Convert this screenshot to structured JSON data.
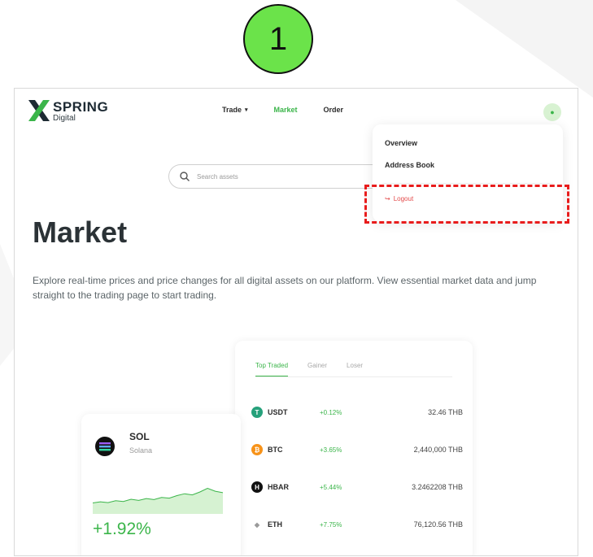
{
  "step_badge": "1",
  "brand": {
    "name": "SPRING",
    "sub": "Digital",
    "mark": "X"
  },
  "nav": {
    "trade": "Trade",
    "market": "Market",
    "order": "Order"
  },
  "dropdown": {
    "overview": "Overview",
    "address_book": "Address Book",
    "logout": "Logout"
  },
  "search": {
    "placeholder": "Search assets"
  },
  "page": {
    "title": "Market",
    "description": "Explore real-time prices and price changes for all digital assets on our platform. View essential market data and jump straight to the trading page to start trading."
  },
  "tabs": [
    "Top Traded",
    "Gainer",
    "Loser"
  ],
  "assets": [
    {
      "symbol": "USDT",
      "change": "+0.12%",
      "price": "32.46 THB",
      "color": "#26a17b",
      "glyph": "T"
    },
    {
      "symbol": "BTC",
      "change": "+3.65%",
      "price": "2,440,000 THB",
      "color": "#f7931a",
      "glyph": "₿"
    },
    {
      "symbol": "HBAR",
      "change": "+5.44%",
      "price": "3.2462208 THB",
      "color": "#111111",
      "glyph": "H"
    },
    {
      "symbol": "ETH",
      "change": "+7.75%",
      "price": "76,120.56 THB",
      "color": "#9a9a9a",
      "glyph": "◆"
    }
  ],
  "featured": {
    "symbol": "SOL",
    "name": "Solana",
    "change": "+1.92%",
    "trend": [
      0.3,
      0.33,
      0.31,
      0.36,
      0.34,
      0.4,
      0.37,
      0.42,
      0.39,
      0.45,
      0.43,
      0.5,
      0.55,
      0.52,
      0.6,
      0.7,
      0.62,
      0.58
    ]
  },
  "colors": {
    "accent": "#3bb54a",
    "logout": "#e34a4a",
    "highlight": "#e81c1c",
    "badge": "#6be34a"
  }
}
